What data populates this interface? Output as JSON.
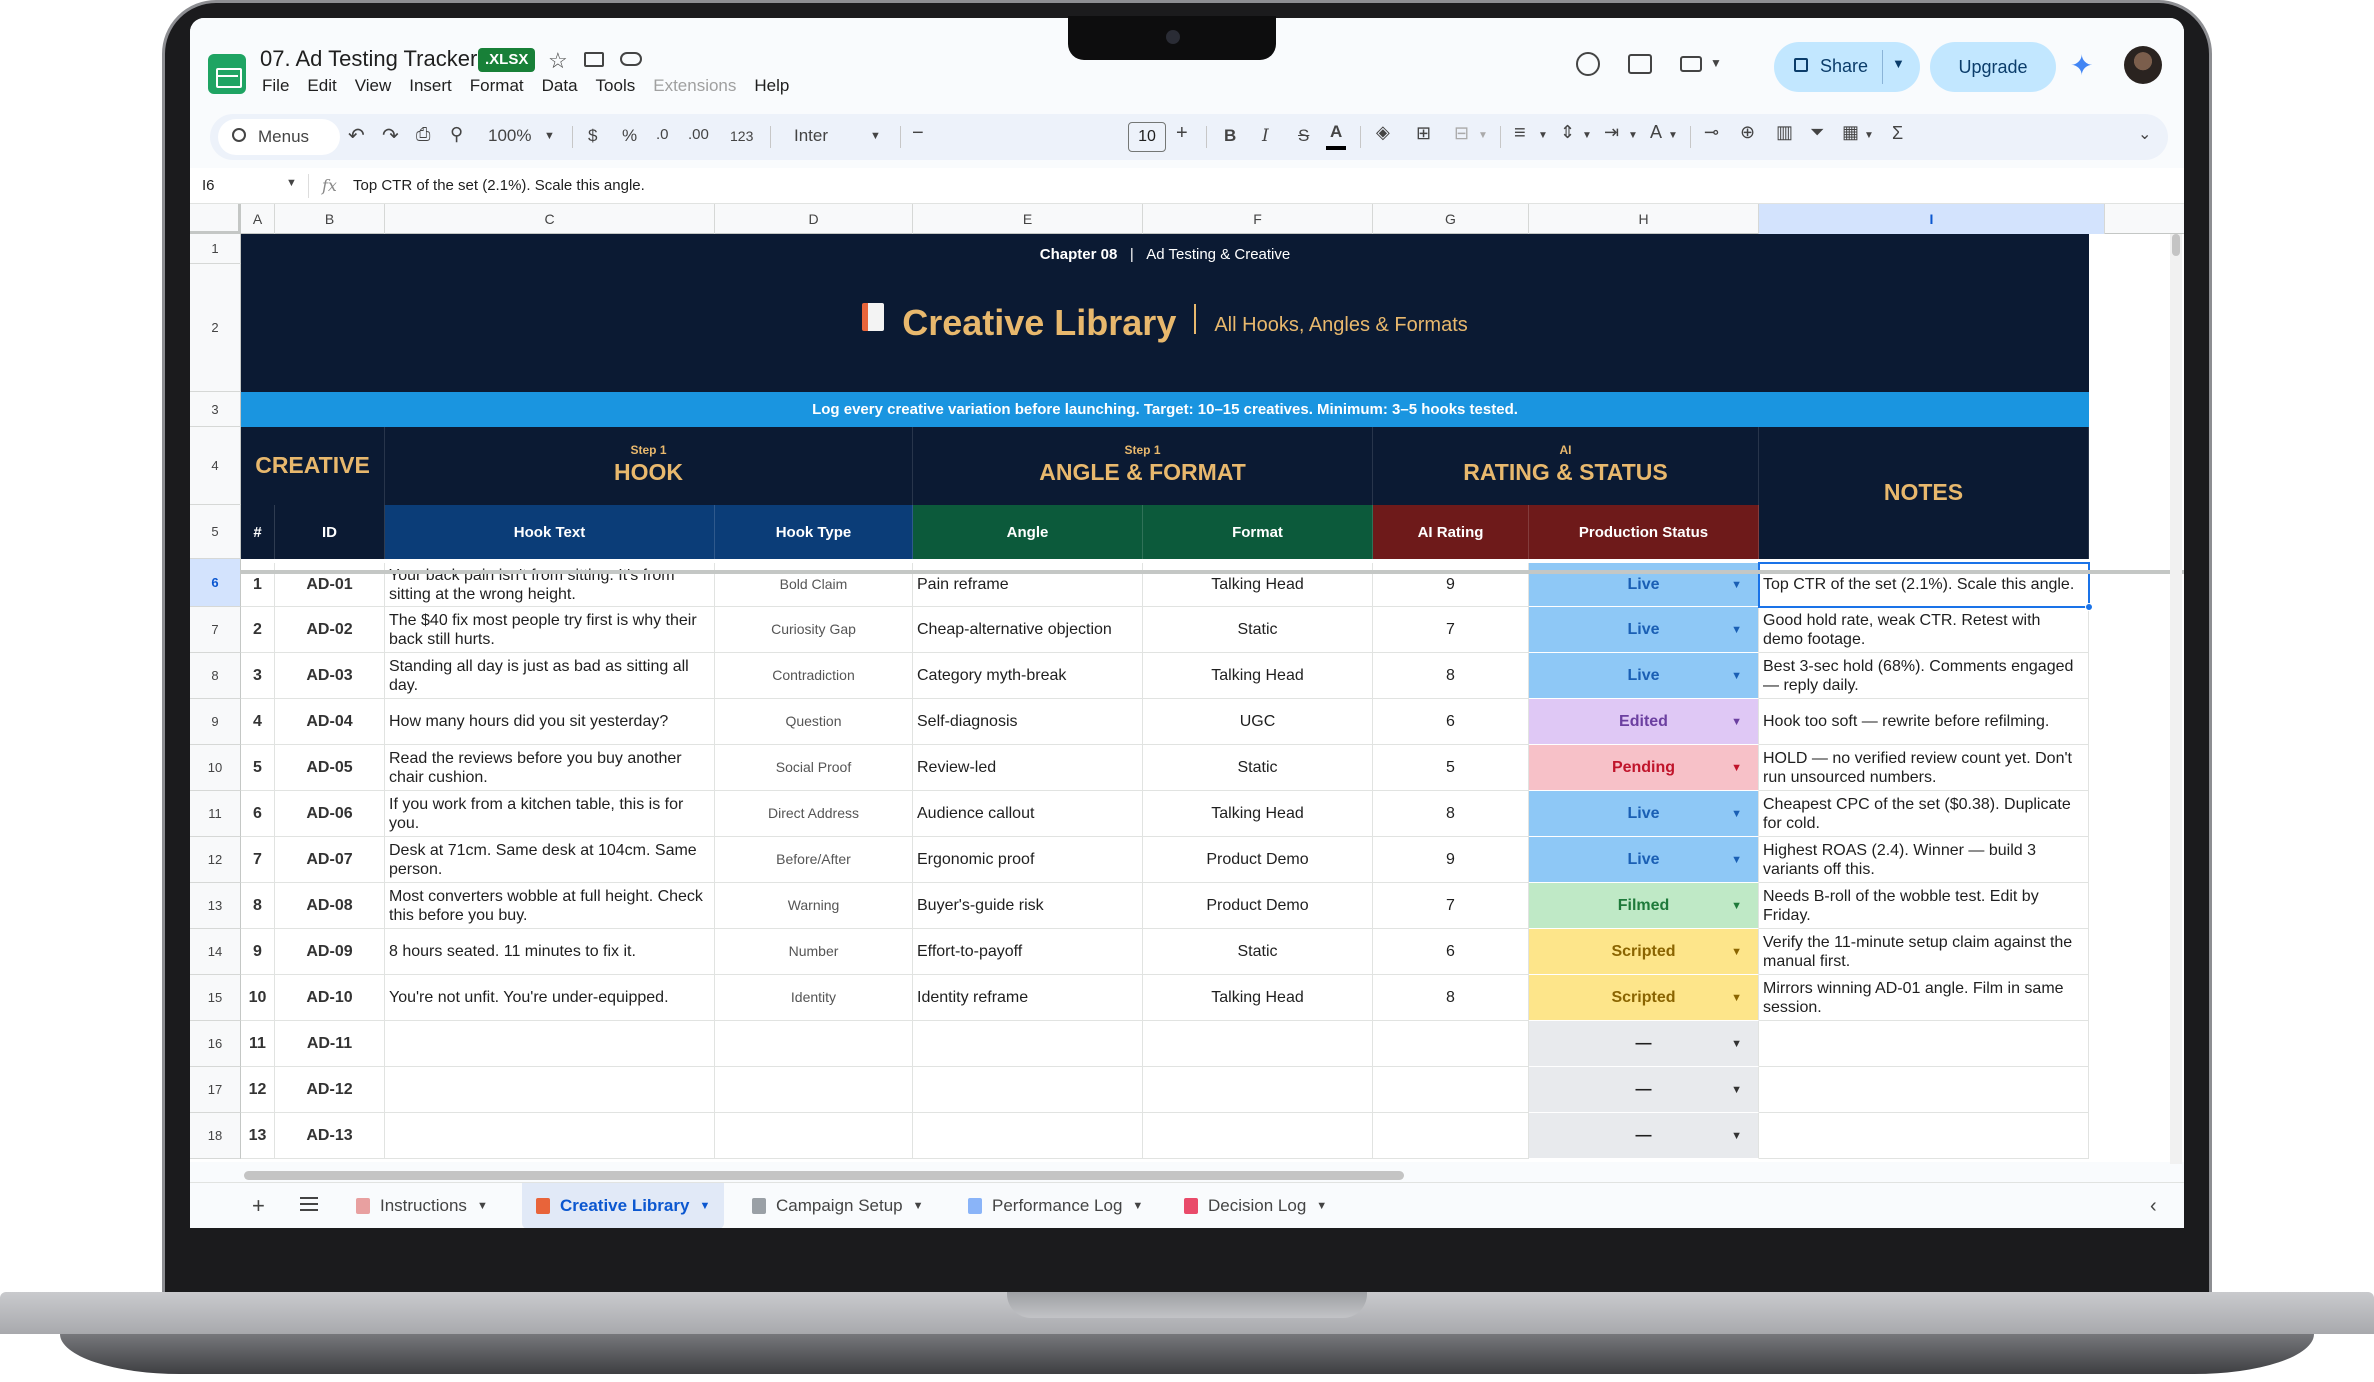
{
  "header": {
    "doc_title": "07. Ad Testing Tracker",
    "file_badge": ".XLSX",
    "menu": [
      "File",
      "Edit",
      "View",
      "Insert",
      "Format",
      "Data",
      "Tools",
      "Extensions",
      "Help"
    ],
    "share_label": "Share",
    "upgrade_label": "Upgrade"
  },
  "toolbar": {
    "search_label": "Menus",
    "zoom": "100%",
    "currency": "$",
    "percent": "%",
    "decrease_decimal": ".0",
    "increase_decimal": ".00",
    "number_format": "123",
    "font": "Inter",
    "font_size": "10",
    "bold": "B",
    "italic": "I",
    "strike": "S",
    "text_color": "A",
    "align_text_color": "A",
    "sum": "Σ"
  },
  "formula_bar": {
    "cell_ref": "I6",
    "fx": "fx",
    "content": "Top CTR of the set (2.1%). Scale this angle."
  },
  "columns": [
    "A",
    "B",
    "C",
    "D",
    "E",
    "F",
    "G",
    "H",
    "I"
  ],
  "rows": [
    "1",
    "2",
    "3",
    "4",
    "5",
    "6",
    "7",
    "8",
    "9",
    "10",
    "11",
    "12",
    "13",
    "14",
    "15",
    "16",
    "17",
    "18"
  ],
  "banner": {
    "chapter_bold": "Chapter 08",
    "chapter_sep": "|",
    "chapter_text": "Ad Testing & Creative",
    "title": "Creative Library",
    "title_sep": "|",
    "subtitle": "All Hooks, Angles & Formats",
    "info": "Log every creative variation before launching. Target: 10–15 creatives. Minimum: 3–5 hooks tested."
  },
  "sections": {
    "creative": {
      "title": "CREATIVE"
    },
    "hook": {
      "step": "Step 1",
      "title": "HOOK"
    },
    "angle_format": {
      "step": "Step 1",
      "title": "ANGLE & FORMAT"
    },
    "rating_status": {
      "step": "AI",
      "title": "RATING & STATUS"
    },
    "notes": {
      "title": "NOTES"
    }
  },
  "sub_headers": {
    "num": "#",
    "id": "ID",
    "hook_text": "Hook Text",
    "hook_type": "Hook Type",
    "angle": "Angle",
    "format": "Format",
    "ai_rating": "AI Rating",
    "production_status": "Production Status"
  },
  "colors": {
    "dark_navy": "#0b1a33",
    "gold": "#e8b86d",
    "info_blue": "#1a95e0",
    "hook_blue": "#0b3d78",
    "angle_green": "#0c5a3b",
    "rating_red": "#6e1a1a",
    "status_live": "#8ec8f6",
    "status_edited": "#dfc8f5",
    "status_pending": "#f7c1c8",
    "status_filmed": "#bfe9c6",
    "status_scripted": "#fde58a",
    "status_empty": "#e8eaed"
  },
  "data_rows": [
    {
      "num": "1",
      "id": "AD-01",
      "hook_text": "Your back pain isn't from sitting. It's from sitting at the wrong height.",
      "hook_type": "Bold Claim",
      "angle": "Pain reframe",
      "format": "Talking Head",
      "rating": "9",
      "status": "Live",
      "notes": "Top CTR of the set (2.1%). Scale this angle."
    },
    {
      "num": "2",
      "id": "AD-02",
      "hook_text": "The $40 fix most people try first is why their back still hurts.",
      "hook_type": "Curiosity Gap",
      "angle": "Cheap-alternative objection",
      "format": "Static",
      "rating": "7",
      "status": "Live",
      "notes": "Good hold rate, weak CTR. Retest with demo footage."
    },
    {
      "num": "3",
      "id": "AD-03",
      "hook_text": "Standing all day is just as bad as sitting all day.",
      "hook_type": "Contradiction",
      "angle": "Category myth-break",
      "format": "Talking Head",
      "rating": "8",
      "status": "Live",
      "notes": "Best 3-sec hold (68%). Comments engaged — reply daily."
    },
    {
      "num": "4",
      "id": "AD-04",
      "hook_text": "How many hours did you sit yesterday?",
      "hook_type": "Question",
      "angle": "Self-diagnosis",
      "format": "UGC",
      "rating": "6",
      "status": "Edited",
      "notes": "Hook too soft — rewrite before refilming."
    },
    {
      "num": "5",
      "id": "AD-05",
      "hook_text": "Read the reviews before you buy another chair cushion.",
      "hook_type": "Social Proof",
      "angle": "Review-led",
      "format": "Static",
      "rating": "5",
      "status": "Pending",
      "notes": "HOLD — no verified review count yet. Don't run unsourced numbers."
    },
    {
      "num": "6",
      "id": "AD-06",
      "hook_text": "If you work from a kitchen table, this is for you.",
      "hook_type": "Direct Address",
      "angle": "Audience callout",
      "format": "Talking Head",
      "rating": "8",
      "status": "Live",
      "notes": "Cheapest CPC of the set ($0.38). Duplicate for cold."
    },
    {
      "num": "7",
      "id": "AD-07",
      "hook_text": "Desk at 71cm. Same desk at 104cm. Same person.",
      "hook_type": "Before/After",
      "angle": "Ergonomic proof",
      "format": "Product Demo",
      "rating": "9",
      "status": "Live",
      "notes": "Highest ROAS (2.4). Winner — build 3 variants off this."
    },
    {
      "num": "8",
      "id": "AD-08",
      "hook_text": "Most converters wobble at full height. Check this before you buy.",
      "hook_type": "Warning",
      "angle": "Buyer's-guide risk",
      "format": "Product Demo",
      "rating": "7",
      "status": "Filmed",
      "notes": "Needs B-roll of the wobble test. Edit by Friday."
    },
    {
      "num": "9",
      "id": "AD-09",
      "hook_text": "8 hours seated. 11 minutes to fix it.",
      "hook_type": "Number",
      "angle": "Effort-to-payoff",
      "format": "Static",
      "rating": "6",
      "status": "Scripted",
      "notes": "Verify the 11-minute setup claim against the manual first."
    },
    {
      "num": "10",
      "id": "AD-10",
      "hook_text": "You're not unfit. You're under-equipped.",
      "hook_type": "Identity",
      "angle": "Identity reframe",
      "format": "Talking Head",
      "rating": "8",
      "status": "Scripted",
      "notes": "Mirrors winning AD-01 angle. Film in same session."
    },
    {
      "num": "11",
      "id": "AD-11",
      "hook_text": "",
      "hook_type": "",
      "angle": "",
      "format": "",
      "rating": "",
      "status": "—",
      "notes": ""
    },
    {
      "num": "12",
      "id": "AD-12",
      "hook_text": "",
      "hook_type": "",
      "angle": "",
      "format": "",
      "rating": "",
      "status": "—",
      "notes": ""
    },
    {
      "num": "13",
      "id": "AD-13",
      "hook_text": "",
      "hook_type": "",
      "angle": "",
      "format": "",
      "rating": "",
      "status": "—",
      "notes": ""
    }
  ],
  "sheet_tabs": [
    {
      "label": "Instructions",
      "icon_color": "#e8a0a0"
    },
    {
      "label": "Creative Library",
      "icon_color": "#e8643a",
      "active": true
    },
    {
      "label": "Campaign Setup",
      "icon_color": "#9aa0a6"
    },
    {
      "label": "Performance Log",
      "icon_color": "#8ab4f8"
    },
    {
      "label": "Decision Log",
      "icon_color": "#e94b6a"
    }
  ]
}
